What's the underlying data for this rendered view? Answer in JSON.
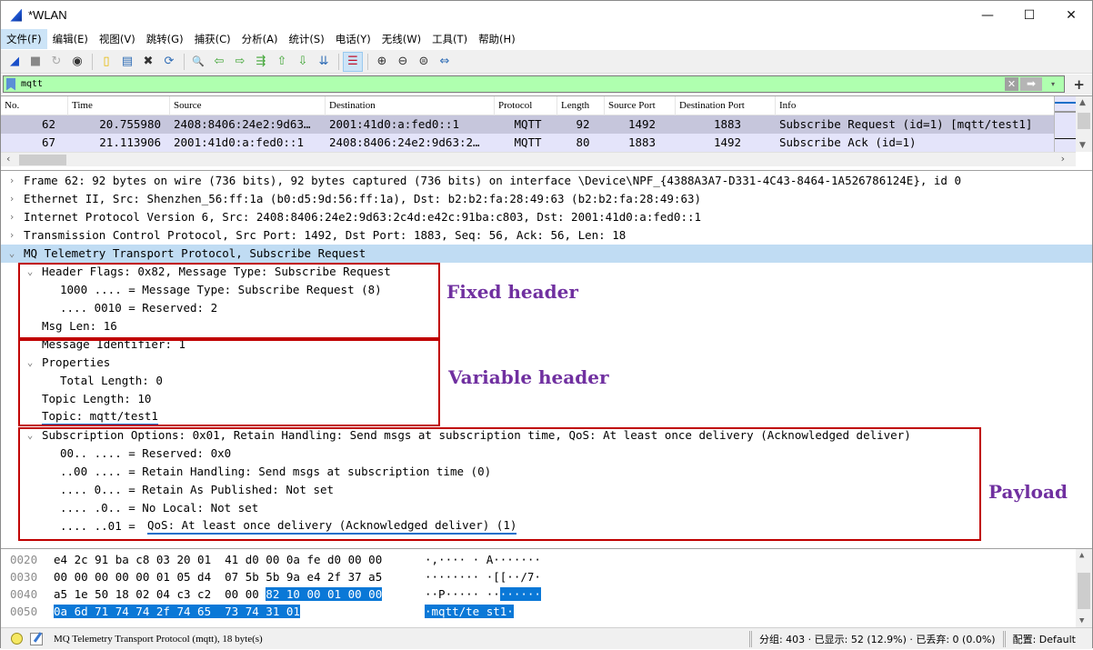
{
  "window": {
    "title": "*WLAN",
    "controls": {
      "minimize": "—",
      "maximize": "☐",
      "close": "✕"
    }
  },
  "menubar": {
    "items": [
      "文件(F)",
      "编辑(E)",
      "视图(V)",
      "跳转(G)",
      "捕获(C)",
      "分析(A)",
      "统计(S)",
      "电话(Y)",
      "无线(W)",
      "工具(T)",
      "帮助(H)"
    ]
  },
  "toolbar": {
    "icons": [
      "start-capture-icon",
      "stop-capture-icon",
      "restart-capture-icon",
      "capture-options-icon",
      "open-file-icon",
      "save-file-icon",
      "close-file-icon",
      "reload-file-icon",
      "find-packet-icon",
      "go-back-icon",
      "go-forward-icon",
      "go-to-packet-icon",
      "first-packet-icon",
      "last-packet-icon",
      "auto-scroll-icon",
      "colorize-icon",
      "zoom-in-icon",
      "zoom-out-icon",
      "normal-size-icon",
      "resize-columns-icon"
    ],
    "glyphs": [
      "◢",
      "■",
      "↻",
      "◉",
      "▯",
      "▤",
      "✖",
      "⟳",
      "🔍",
      "⇦",
      "⇨",
      "⇶",
      "⇧",
      "⇩",
      "⇊",
      "☰",
      "⊕",
      "⊖",
      "⊜",
      "⇔"
    ]
  },
  "filter": {
    "value": "mqtt",
    "clear": "✕",
    "apply": "➡",
    "dropdown": "▾",
    "add": "+"
  },
  "packet_list": {
    "columns": [
      "No.",
      "Time",
      "Source",
      "Destination",
      "Protocol",
      "Length",
      "Source Port",
      "Destination Port",
      "Info"
    ],
    "rows": [
      {
        "no": "62",
        "time": "20.755980",
        "source": "2408:8406:24e2:9d63…",
        "destination": "2001:41d0:a:fed0::1",
        "protocol": "MQTT",
        "length": "92",
        "sport": "1492",
        "dport": "1883",
        "info": "Subscribe Request (id=1) [mqtt/test1]"
      },
      {
        "no": "67",
        "time": "21.113906",
        "source": "2001:41d0:a:fed0::1",
        "destination": "2408:8406:24e2:9d63:2…",
        "protocol": "MQTT",
        "length": "80",
        "sport": "1883",
        "dport": "1492",
        "info": "Subscribe Ack (id=1)"
      }
    ]
  },
  "details": {
    "frame": "Frame 62: 92 bytes on wire (736 bits), 92 bytes captured (736 bits) on interface \\Device\\NPF_{4388A3A7-D331-4C43-8464-1A526786124E}, id 0",
    "ethernet": "Ethernet II, Src: Shenzhen_56:ff:1a (b0:d5:9d:56:ff:1a), Dst: b2:b2:fa:28:49:63 (b2:b2:fa:28:49:63)",
    "ipv6": "Internet Protocol Version 6, Src: 2408:8406:24e2:9d63:2c4d:e42c:91ba:c803, Dst: 2001:41d0:a:fed0::1",
    "tcp": "Transmission Control Protocol, Src Port: 1492, Dst Port: 1883, Seq: 56, Ack: 56, Len: 18",
    "mqtt": "MQ Telemetry Transport Protocol, Subscribe Request",
    "header_flags": "Header Flags: 0x82, Message Type: Subscribe Request",
    "msg_type": "1000 .... = Message Type: Subscribe Request (8)",
    "reserved": ".... 0010 = Reserved: 2",
    "msg_len": "Msg Len: 16",
    "msg_id": "Message Identifier: 1",
    "properties": "Properties",
    "total_length": "Total Length: 0",
    "topic_length": "Topic Length: 10",
    "topic": "Topic: mqtt/test1",
    "sub_options": "Subscription Options: 0x01, Retain Handling: Send msgs at subscription time, QoS: At least once delivery (Acknowledged deliver)",
    "opt_reserved": "00.. .... = Reserved: 0x0",
    "opt_retain_handling": "..00 .... = Retain Handling: Send msgs at subscription time (0)",
    "opt_rap_prefix": ".... 0... = Retain As Published: Not set",
    "opt_nolocal": ".... .0.. = No Local: Not set",
    "opt_qos_prefix": ".... ..01 = ",
    "opt_qos": "QoS: At least once delivery (Acknowledged deliver) (1)"
  },
  "annotations": {
    "fixed": "Fixed header",
    "variable": "Variable header",
    "payload": "Payload",
    "box_color": "#c00000",
    "text_color": "#7030a0"
  },
  "bytes": {
    "rows": [
      {
        "offset": "0020",
        "hex_plain": "e4 2c 91 ba c8 03 20 01  41 d0 00 0a fe d0 00 00",
        "hex_hl": "",
        "ascii_plain": "·,···· · A·······",
        "ascii_hl": ""
      },
      {
        "offset": "0030",
        "hex_plain": "00 00 00 00 00 01 05 d4  07 5b 5b 9a e4 2f 37 a5",
        "hex_hl": "",
        "ascii_plain": "········ ·[[··/7·",
        "ascii_hl": ""
      },
      {
        "offset": "0040",
        "hex_plain": "a5 1e 50 18 02 04 c3 c2  00 00 ",
        "hex_hl": "82 10 00 01 00 00",
        "ascii_plain": "··P····· ··",
        "ascii_hl": "······"
      },
      {
        "offset": "0050",
        "hex_plain": "",
        "hex_hl": "0a 6d 71 74 74 2f 74 65  73 74 31 01",
        "ascii_plain": "",
        "ascii_hl": "·mqtt/te st1·"
      }
    ]
  },
  "statusbar": {
    "field_info": "MQ Telemetry Transport Protocol (mqtt), 18 byte(s)",
    "packets": "分组: 403 · 已显示: 52 (12.9%) · 已丢弃: 0 (0.0%)",
    "profile": "配置: Default"
  }
}
